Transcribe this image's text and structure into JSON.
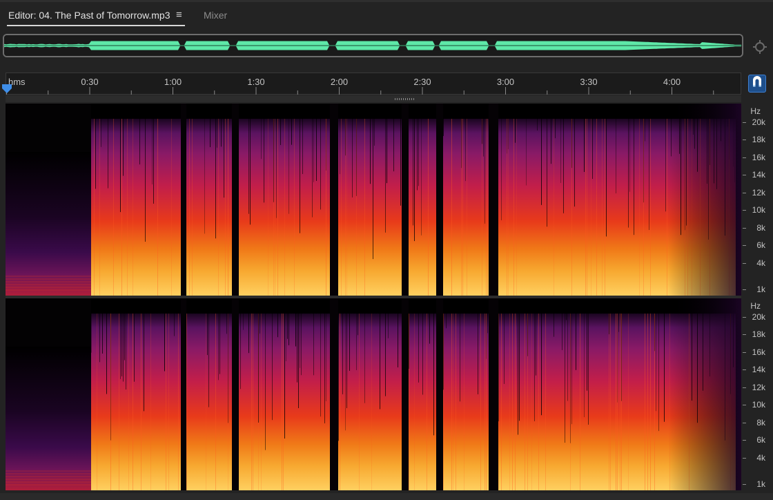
{
  "tabs": {
    "editor_label": "Editor: 04. The Past of Tomorrow.mp3",
    "menu_glyph": "≡",
    "mixer_label": "Mixer"
  },
  "overview": {
    "waveform_color": "#5ee8a8",
    "zoom_icon": "zoom-navigator-icon"
  },
  "timeline": {
    "unit": "hms",
    "labels": [
      "0:30",
      "1:00",
      "1:30",
      "2:00",
      "2:30",
      "3:00",
      "3:30",
      "4:00"
    ],
    "snap_icon": "magnet-icon",
    "playhead_color": "#3f8ee8"
  },
  "spectral": {
    "hz_unit": "Hz",
    "hz_labels": [
      "20k",
      "18k",
      "16k",
      "14k",
      "12k",
      "10k",
      "8k",
      "6k",
      "4k",
      "1k"
    ],
    "palette": [
      "#000000",
      "#3a0a4a",
      "#7a1770",
      "#c21e4a",
      "#e83a1a",
      "#f58a1a",
      "#ffd060"
    ]
  }
}
